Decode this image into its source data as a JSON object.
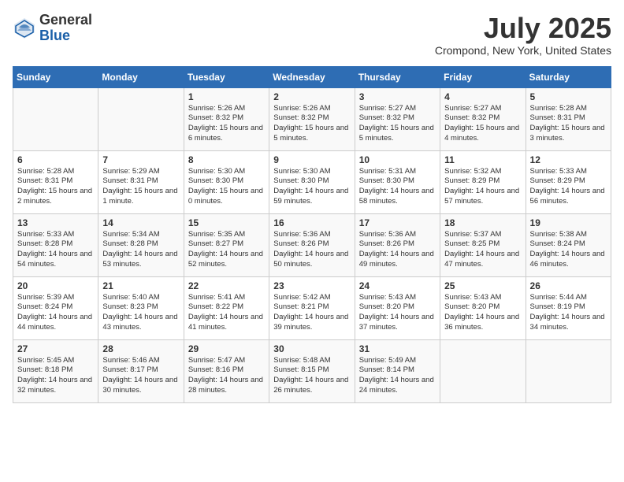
{
  "header": {
    "logo_general": "General",
    "logo_blue": "Blue",
    "month_title": "July 2025",
    "location": "Crompond, New York, United States"
  },
  "days_of_week": [
    "Sunday",
    "Monday",
    "Tuesday",
    "Wednesday",
    "Thursday",
    "Friday",
    "Saturday"
  ],
  "weeks": [
    [
      {
        "day": null
      },
      {
        "day": null
      },
      {
        "day": 1,
        "sunrise": "Sunrise: 5:26 AM",
        "sunset": "Sunset: 8:32 PM",
        "daylight": "Daylight: 15 hours and 6 minutes."
      },
      {
        "day": 2,
        "sunrise": "Sunrise: 5:26 AM",
        "sunset": "Sunset: 8:32 PM",
        "daylight": "Daylight: 15 hours and 5 minutes."
      },
      {
        "day": 3,
        "sunrise": "Sunrise: 5:27 AM",
        "sunset": "Sunset: 8:32 PM",
        "daylight": "Daylight: 15 hours and 5 minutes."
      },
      {
        "day": 4,
        "sunrise": "Sunrise: 5:27 AM",
        "sunset": "Sunset: 8:32 PM",
        "daylight": "Daylight: 15 hours and 4 minutes."
      },
      {
        "day": 5,
        "sunrise": "Sunrise: 5:28 AM",
        "sunset": "Sunset: 8:31 PM",
        "daylight": "Daylight: 15 hours and 3 minutes."
      }
    ],
    [
      {
        "day": 6,
        "sunrise": "Sunrise: 5:28 AM",
        "sunset": "Sunset: 8:31 PM",
        "daylight": "Daylight: 15 hours and 2 minutes."
      },
      {
        "day": 7,
        "sunrise": "Sunrise: 5:29 AM",
        "sunset": "Sunset: 8:31 PM",
        "daylight": "Daylight: 15 hours and 1 minute."
      },
      {
        "day": 8,
        "sunrise": "Sunrise: 5:30 AM",
        "sunset": "Sunset: 8:30 PM",
        "daylight": "Daylight: 15 hours and 0 minutes."
      },
      {
        "day": 9,
        "sunrise": "Sunrise: 5:30 AM",
        "sunset": "Sunset: 8:30 PM",
        "daylight": "Daylight: 14 hours and 59 minutes."
      },
      {
        "day": 10,
        "sunrise": "Sunrise: 5:31 AM",
        "sunset": "Sunset: 8:30 PM",
        "daylight": "Daylight: 14 hours and 58 minutes."
      },
      {
        "day": 11,
        "sunrise": "Sunrise: 5:32 AM",
        "sunset": "Sunset: 8:29 PM",
        "daylight": "Daylight: 14 hours and 57 minutes."
      },
      {
        "day": 12,
        "sunrise": "Sunrise: 5:33 AM",
        "sunset": "Sunset: 8:29 PM",
        "daylight": "Daylight: 14 hours and 56 minutes."
      }
    ],
    [
      {
        "day": 13,
        "sunrise": "Sunrise: 5:33 AM",
        "sunset": "Sunset: 8:28 PM",
        "daylight": "Daylight: 14 hours and 54 minutes."
      },
      {
        "day": 14,
        "sunrise": "Sunrise: 5:34 AM",
        "sunset": "Sunset: 8:28 PM",
        "daylight": "Daylight: 14 hours and 53 minutes."
      },
      {
        "day": 15,
        "sunrise": "Sunrise: 5:35 AM",
        "sunset": "Sunset: 8:27 PM",
        "daylight": "Daylight: 14 hours and 52 minutes."
      },
      {
        "day": 16,
        "sunrise": "Sunrise: 5:36 AM",
        "sunset": "Sunset: 8:26 PM",
        "daylight": "Daylight: 14 hours and 50 minutes."
      },
      {
        "day": 17,
        "sunrise": "Sunrise: 5:36 AM",
        "sunset": "Sunset: 8:26 PM",
        "daylight": "Daylight: 14 hours and 49 minutes."
      },
      {
        "day": 18,
        "sunrise": "Sunrise: 5:37 AM",
        "sunset": "Sunset: 8:25 PM",
        "daylight": "Daylight: 14 hours and 47 minutes."
      },
      {
        "day": 19,
        "sunrise": "Sunrise: 5:38 AM",
        "sunset": "Sunset: 8:24 PM",
        "daylight": "Daylight: 14 hours and 46 minutes."
      }
    ],
    [
      {
        "day": 20,
        "sunrise": "Sunrise: 5:39 AM",
        "sunset": "Sunset: 8:24 PM",
        "daylight": "Daylight: 14 hours and 44 minutes."
      },
      {
        "day": 21,
        "sunrise": "Sunrise: 5:40 AM",
        "sunset": "Sunset: 8:23 PM",
        "daylight": "Daylight: 14 hours and 43 minutes."
      },
      {
        "day": 22,
        "sunrise": "Sunrise: 5:41 AM",
        "sunset": "Sunset: 8:22 PM",
        "daylight": "Daylight: 14 hours and 41 minutes."
      },
      {
        "day": 23,
        "sunrise": "Sunrise: 5:42 AM",
        "sunset": "Sunset: 8:21 PM",
        "daylight": "Daylight: 14 hours and 39 minutes."
      },
      {
        "day": 24,
        "sunrise": "Sunrise: 5:43 AM",
        "sunset": "Sunset: 8:20 PM",
        "daylight": "Daylight: 14 hours and 37 minutes."
      },
      {
        "day": 25,
        "sunrise": "Sunrise: 5:43 AM",
        "sunset": "Sunset: 8:20 PM",
        "daylight": "Daylight: 14 hours and 36 minutes."
      },
      {
        "day": 26,
        "sunrise": "Sunrise: 5:44 AM",
        "sunset": "Sunset: 8:19 PM",
        "daylight": "Daylight: 14 hours and 34 minutes."
      }
    ],
    [
      {
        "day": 27,
        "sunrise": "Sunrise: 5:45 AM",
        "sunset": "Sunset: 8:18 PM",
        "daylight": "Daylight: 14 hours and 32 minutes."
      },
      {
        "day": 28,
        "sunrise": "Sunrise: 5:46 AM",
        "sunset": "Sunset: 8:17 PM",
        "daylight": "Daylight: 14 hours and 30 minutes."
      },
      {
        "day": 29,
        "sunrise": "Sunrise: 5:47 AM",
        "sunset": "Sunset: 8:16 PM",
        "daylight": "Daylight: 14 hours and 28 minutes."
      },
      {
        "day": 30,
        "sunrise": "Sunrise: 5:48 AM",
        "sunset": "Sunset: 8:15 PM",
        "daylight": "Daylight: 14 hours and 26 minutes."
      },
      {
        "day": 31,
        "sunrise": "Sunrise: 5:49 AM",
        "sunset": "Sunset: 8:14 PM",
        "daylight": "Daylight: 14 hours and 24 minutes."
      },
      {
        "day": null
      },
      {
        "day": null
      }
    ]
  ]
}
